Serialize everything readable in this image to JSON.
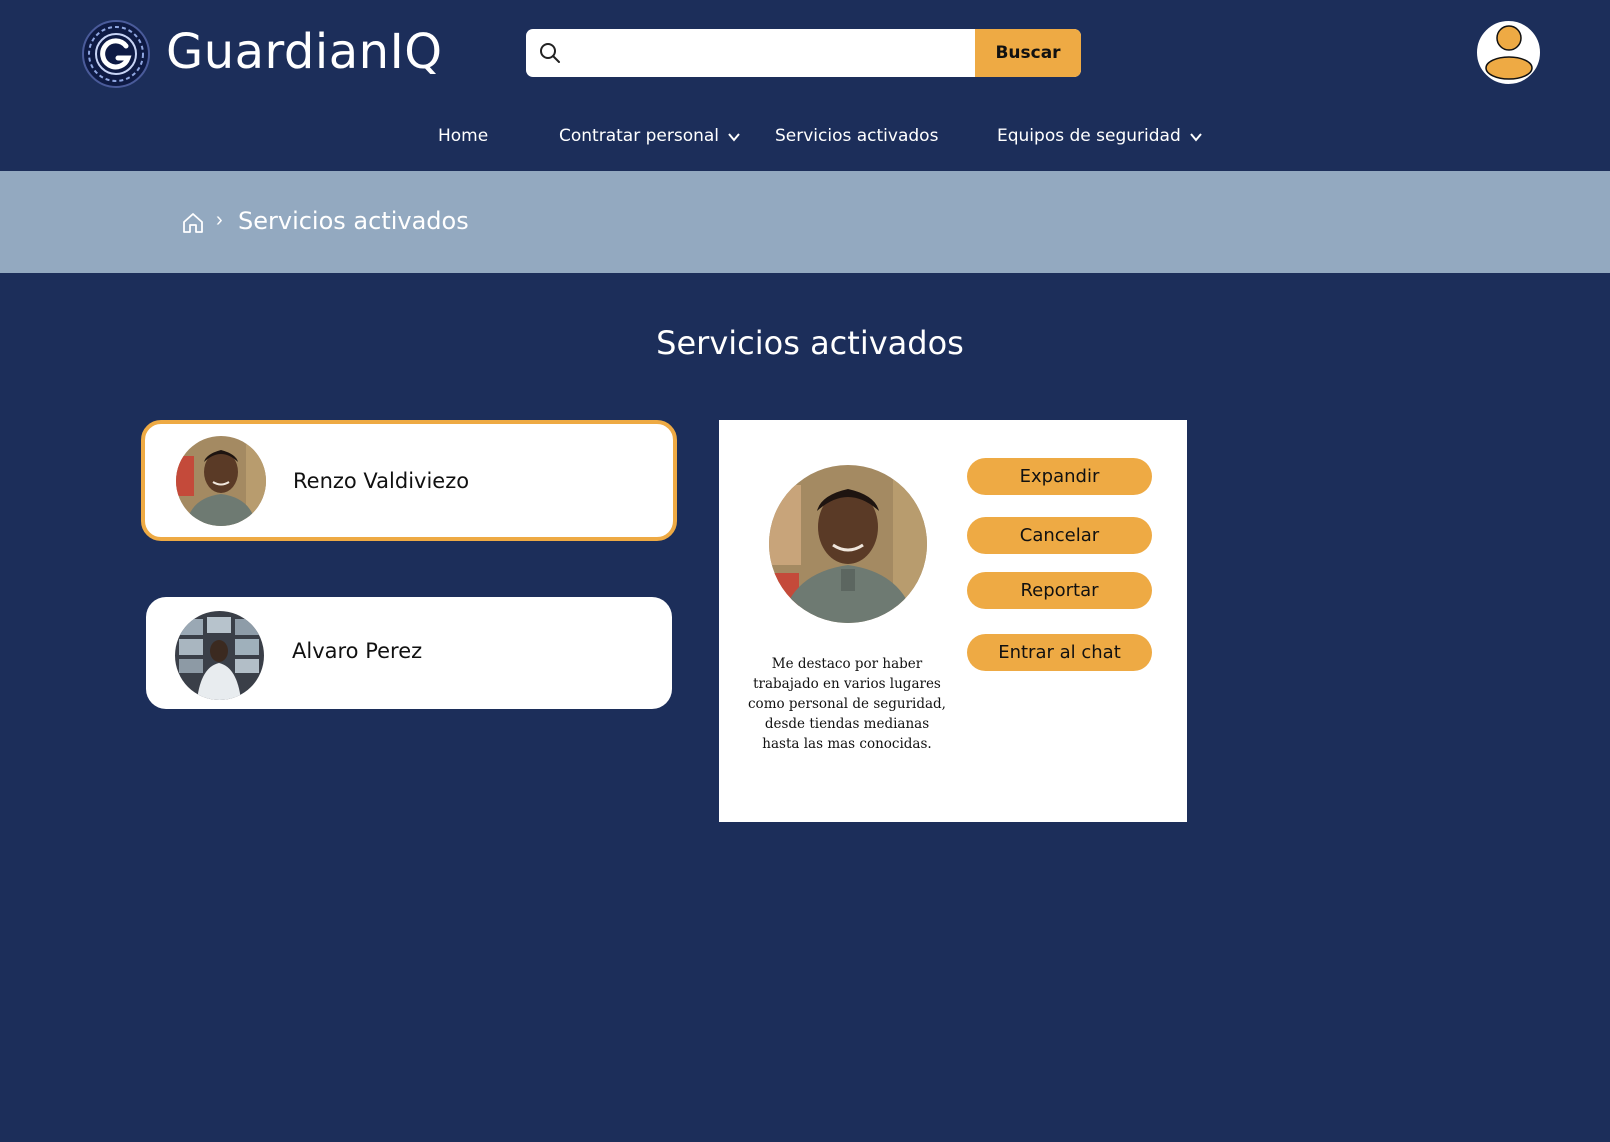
{
  "app": {
    "brand": "GuardianIQ"
  },
  "search": {
    "placeholder": "",
    "value": "",
    "button_label": "Buscar"
  },
  "nav": {
    "items": [
      {
        "label": "Home"
      },
      {
        "label": "Contratar personal"
      },
      {
        "label": "Servicios activados"
      },
      {
        "label": "Equipos de seguridad"
      }
    ]
  },
  "breadcrumb": {
    "current": "Servicios activados"
  },
  "page": {
    "title": "Servicios activados"
  },
  "people": [
    {
      "name": "Renzo Valdiviezo",
      "selected": true
    },
    {
      "name": "Alvaro Perez",
      "selected": false
    }
  ],
  "detail": {
    "description": "Me destaco por haber trabajado en varios lugares como personal de seguridad, desde tiendas medianas hasta las mas conocidas.",
    "actions": [
      {
        "label": "Expandir"
      },
      {
        "label": "Cancelar"
      },
      {
        "label": "Reportar"
      },
      {
        "label": "Entrar al chat"
      }
    ]
  },
  "colors": {
    "background": "#1c2e5a",
    "accent": "#eeaa44",
    "breadcrumb_band": "#93a9c0",
    "card": "#ffffff"
  },
  "icons": [
    "logo-icon",
    "search-icon",
    "user-icon",
    "chevron-down-icon",
    "home-icon"
  ]
}
